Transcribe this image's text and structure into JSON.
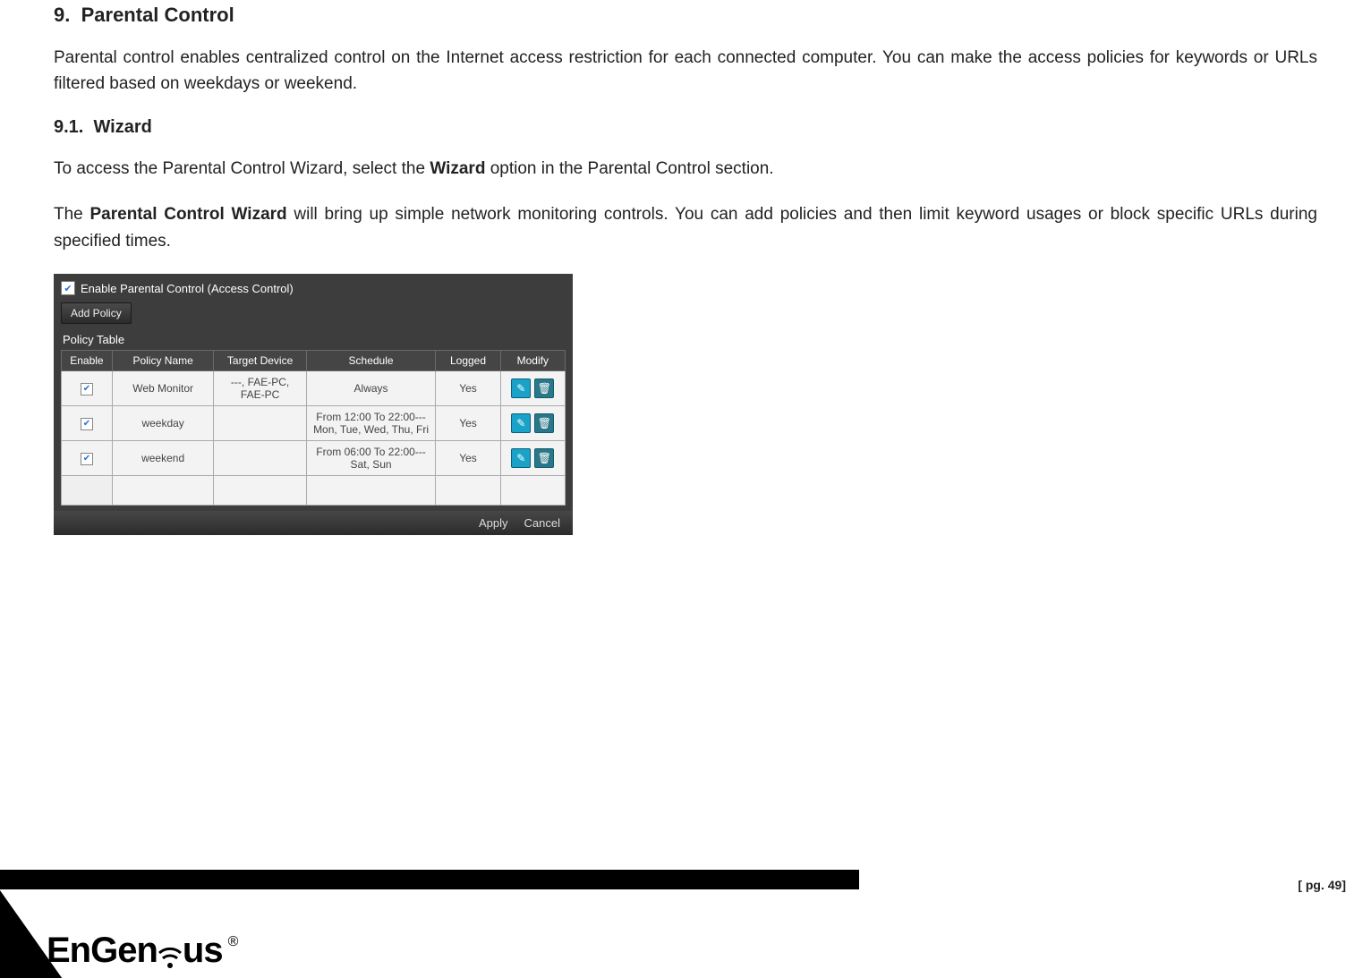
{
  "document": {
    "section_number": "9.",
    "section_title": "Parental Control",
    "intro": "Parental control enables centralized control on the Internet access restriction for each connected computer. You can make the access policies for keywords or URLs filtered based on weekdays or weekend.",
    "sub_number": "9.1.",
    "sub_title": "Wizard",
    "p2_a": "To access the Parental Control Wizard, select the ",
    "p2_bold": "Wizard",
    "p2_b": " option in the Parental Control section.",
    "p3_a": "The ",
    "p3_bold": "Parental Control Wizard",
    "p3_b": " will bring up simple network monitoring controls. You can add policies and then limit keyword usages or block specific URLs during specified times."
  },
  "panel": {
    "enable_label": "Enable Parental Control (Access Control)",
    "add_policy": "Add Policy",
    "table_title": "Policy Table",
    "headers": {
      "enable": "Enable",
      "policy": "Policy Name",
      "device": "Target Device",
      "schedule": "Schedule",
      "logged": "Logged",
      "modify": "Modify"
    },
    "rows": [
      {
        "name": "Web Monitor",
        "device": "---, FAE-PC, FAE-PC",
        "schedule": "Always",
        "logged": "Yes"
      },
      {
        "name": "weekday",
        "device": "",
        "schedule": "From 12:00 To 22:00---Mon, Tue, Wed, Thu, Fri",
        "logged": "Yes"
      },
      {
        "name": "weekend",
        "device": "",
        "schedule": "From 06:00 To 22:00---Sat, Sun",
        "logged": "Yes"
      }
    ],
    "apply": "Apply",
    "cancel": "Cancel"
  },
  "footer": {
    "brand": "EnGenius",
    "page_label": "[ pg. 49]"
  }
}
